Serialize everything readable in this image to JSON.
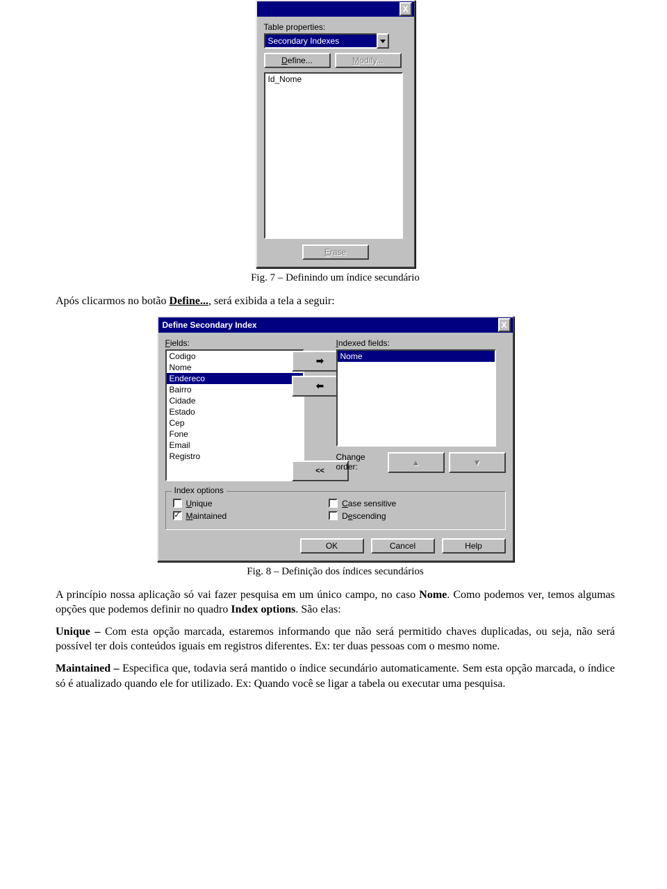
{
  "dialog1": {
    "label_table_properties": "Table properties:",
    "combo_value": "Secondary Indexes",
    "btn_define": "Define...",
    "btn_modify": "Modify...",
    "list_items": [
      "Id_Nome"
    ],
    "btn_erase": "Erase",
    "close_x": "X"
  },
  "caption1": "Fig. 7 – Definindo um índice secundário",
  "para1_pre": "Após clicarmos no botão ",
  "para1_link": "Define...",
  "para1_post": ", será exibida a tela a seguir:",
  "dialog2": {
    "title": "Define Secondary Index",
    "close_x": "X",
    "label_fields": "Fields:",
    "label_indexed": "Indexed fields:",
    "fields": [
      "Codigo",
      "Nome",
      "Endereco",
      "Bairro",
      "Cidade",
      "Estado",
      "Cep",
      "Fone",
      "Email",
      "Registro"
    ],
    "fields_selected_index": 2,
    "indexed": [
      "Nome"
    ],
    "indexed_selected_index": 0,
    "arrow_right": "➡",
    "arrow_left": "⬅",
    "clear_all": "<<",
    "label_change_order": "Change order:",
    "up_glyph": "▲",
    "down_glyph": "▼",
    "group_label": "Index options",
    "chk_unique": "Unique",
    "chk_maintained": "Maintained",
    "maintained_checked": "✓",
    "chk_case": "Case sensitive",
    "chk_descending": "Descending",
    "btn_ok": "OK",
    "btn_cancel": "Cancel",
    "btn_help": "Help"
  },
  "caption2": "Fig. 8 – Definição dos índices secundários",
  "para2": "A princípio nossa aplicação só vai fazer pesquisa em um único campo, no caso Nome. Como podemos ver, temos algumas opções que podemos definir no quadro Index options. São elas:",
  "para3_b": "Unique – ",
  "para3": "Com esta opção marcada, estaremos informando que não será permitido chaves duplicadas, ou seja, não será possível ter dois conteúdos iguais em registros diferentes. Ex: ter duas pessoas com o mesmo nome.",
  "para4_b": "Maintained – ",
  "para4": "Especifica que, todavia será mantido o índice secundário automaticamente. Sem esta opção marcada, o índice só é atualizado quando ele for utilizado. Ex: Quando você se ligar a tabela ou executar uma pesquisa."
}
